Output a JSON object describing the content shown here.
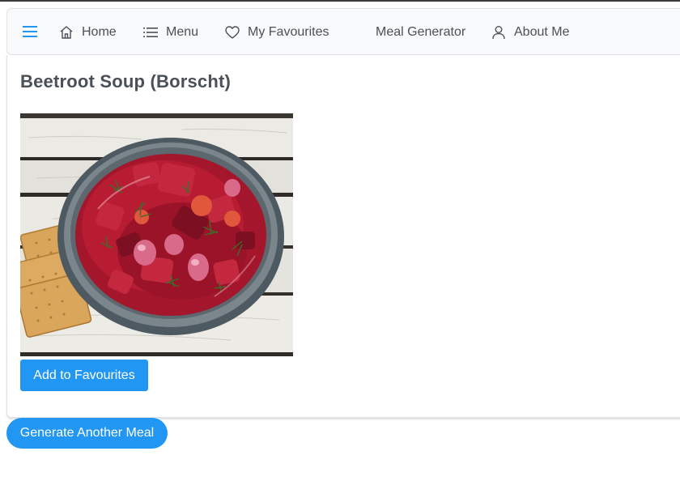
{
  "nav": {
    "items": [
      {
        "label": "Home",
        "icon": "home-icon"
      },
      {
        "label": "Menu",
        "icon": "list-icon"
      },
      {
        "label": "My Favourites",
        "icon": "heart-icon"
      },
      {
        "label": "Meal Generator",
        "icon": ""
      },
      {
        "label": "About Me",
        "icon": "user-icon"
      }
    ],
    "toggle_icon": "hamburger-icon",
    "accent": "#2196f3"
  },
  "meal": {
    "title": "Beetroot Soup (Borscht)",
    "add_favourite_label": "Add to Favourites"
  },
  "generate_label": "Generate Another Meal",
  "colors": {
    "primary": "#2196f3",
    "navbar_bg": "#f8f9fa",
    "text": "#495057"
  }
}
